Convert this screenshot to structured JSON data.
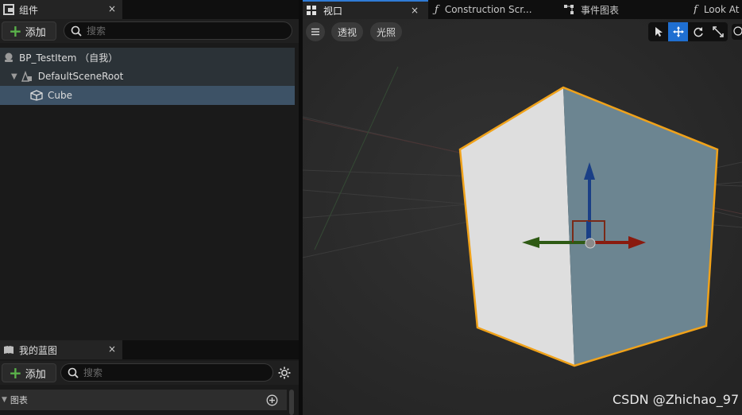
{
  "components_panel": {
    "tab_title": "组件",
    "close": "×",
    "add_label": "添加",
    "search_placeholder": "搜索",
    "tree": {
      "root": "BP_TestItem （自我）",
      "scene_root": "DefaultSceneRoot",
      "cube": "Cube"
    }
  },
  "blueprint_panel": {
    "tab_title": "我的蓝图",
    "close": "×",
    "add_label": "添加",
    "search_placeholder": "搜索",
    "section": "图表"
  },
  "viewport_tabs": [
    {
      "label": "视口",
      "close": "×"
    },
    {
      "label": "Construction Scr..."
    },
    {
      "label": "事件图表"
    },
    {
      "label": "Look At"
    }
  ],
  "viewport": {
    "perspective_label": "透视",
    "lighting_label": "光照",
    "cube_colors": {
      "outline": "#f0a21a",
      "face_left": "#dcdcdc",
      "face_right": "#6c8591"
    },
    "gizmo_colors": {
      "x": "#8a1a0e",
      "y": "#2e5a14",
      "z": "#1a3f86"
    }
  },
  "watermark": "CSDN @Zhichao_97"
}
